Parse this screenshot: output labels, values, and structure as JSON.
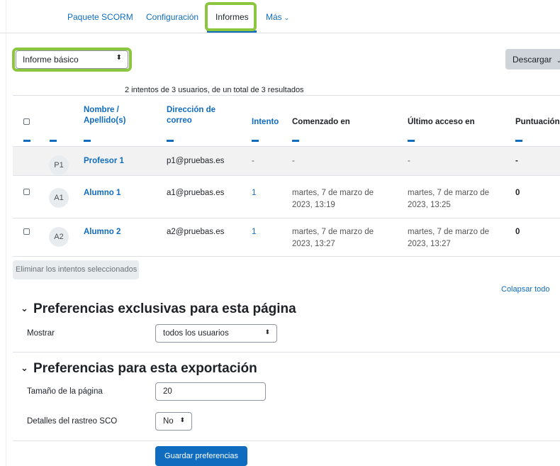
{
  "nav": {
    "tabs": [
      {
        "label": "Paquete SCORM"
      },
      {
        "label": "Configuración"
      },
      {
        "label": "Informes"
      },
      {
        "label": "Más"
      }
    ],
    "more_chevron": "⌄"
  },
  "report_select": {
    "value": "Informe básico",
    "arrow": "⬍"
  },
  "download_button": {
    "label": "Descargar",
    "chevron": "⌄"
  },
  "summary": "2 intentos de 3 usuarios, de un total de 3 resultados",
  "table": {
    "headers": {
      "name": "Nombre / Apellido(s)",
      "email": "Dirección de correo",
      "attempt": "Intento",
      "started": "Comenzado en",
      "last_access": "Último acceso en",
      "score": "Puntuación"
    },
    "rows": [
      {
        "initials": "P1",
        "name": "Profesor 1",
        "email": "p1@pruebas.es",
        "attempt": "-",
        "started": "-",
        "last_access": "-",
        "score": "-",
        "has_checkbox": false
      },
      {
        "initials": "A1",
        "name": "Alumno 1",
        "email": "a1@pruebas.es",
        "attempt": "1",
        "started": "martes, 7 de marzo de 2023, 13:19",
        "last_access": "martes, 7 de marzo de 2023, 13:25",
        "score": "0",
        "has_checkbox": true
      },
      {
        "initials": "A2",
        "name": "Alumno 2",
        "email": "a2@pruebas.es",
        "attempt": "1",
        "started": "martes, 7 de marzo de 2023, 13:27",
        "last_access": "martes, 7 de marzo de 2023, 13:27",
        "score": "0",
        "has_checkbox": true
      }
    ]
  },
  "delete_button": "Eliminar los intentos seleccionados",
  "collapse_link": "Colapsar todo",
  "section1": {
    "title": "Preferencias exclusivas para esta página",
    "show_label": "Mostrar",
    "show_value": "todos los usuarios"
  },
  "section2": {
    "title": "Preferencias para esta exportación",
    "page_size_label": "Tamaño de la página",
    "page_size_value": "20",
    "sco_label": "Detalles del rastreo SCO",
    "sco_value": "No"
  },
  "save_button": "Guardar preferencias",
  "colors": {
    "accent": "#0f6cbf",
    "highlight": "#8cc63f"
  }
}
